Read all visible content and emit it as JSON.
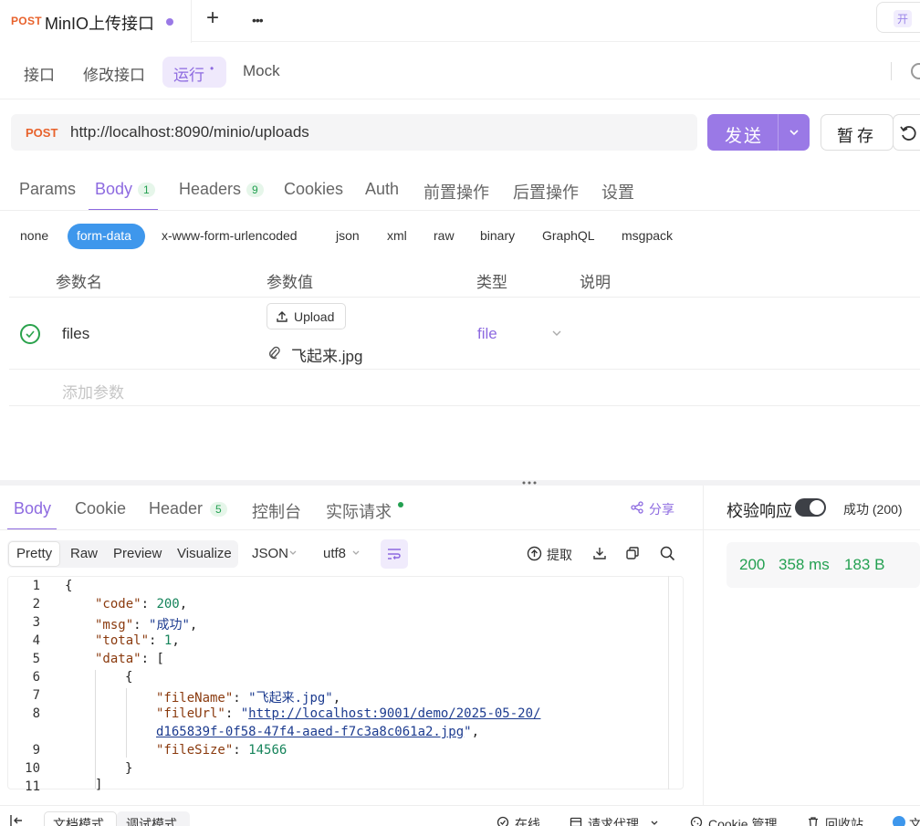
{
  "tab": {
    "method": "POST",
    "title": "MinIO上传接口",
    "add": "+",
    "more": "•••",
    "open": "开"
  },
  "subnav": {
    "items": [
      "接口",
      "修改接口",
      "运行",
      "Mock"
    ],
    "active_dot": "•"
  },
  "url": {
    "method": "POST",
    "value": "http://localhost:8090/minio/uploads"
  },
  "actions": {
    "send": "发送",
    "save": "暂存"
  },
  "request_tabs": [
    {
      "label": "Params"
    },
    {
      "label": "Body",
      "badge": "1"
    },
    {
      "label": "Headers",
      "badge": "9"
    },
    {
      "label": "Cookies"
    },
    {
      "label": "Auth"
    },
    {
      "label": "前置操作"
    },
    {
      "label": "后置操作"
    },
    {
      "label": "设置"
    }
  ],
  "body_types": [
    "none",
    "form-data",
    "x-www-form-urlencoded",
    "json",
    "xml",
    "raw",
    "binary",
    "GraphQL",
    "msgpack"
  ],
  "params_table": {
    "headers": [
      "参数名",
      "参数值",
      "类型",
      "说明"
    ],
    "rows": [
      {
        "name": "files",
        "upload_label": "Upload",
        "file": "飞起来.jpg",
        "type": "file"
      }
    ],
    "add_placeholder": "添加参数"
  },
  "response_tabs": [
    {
      "label": "Body"
    },
    {
      "label": "Cookie"
    },
    {
      "label": "Header",
      "badge": "5"
    },
    {
      "label": "控制台"
    },
    {
      "label": "实际请求"
    }
  ],
  "share": "分享",
  "format": {
    "modes": [
      "Pretty",
      "Raw",
      "Preview",
      "Visualize"
    ],
    "lang": "JSON",
    "encoding": "utf8",
    "extract": "提取"
  },
  "code": {
    "line_numbers": [
      "1",
      "2",
      "3",
      "4",
      "5",
      "6",
      "7",
      "8",
      "",
      "9",
      "10",
      "11"
    ],
    "open_brace": "{",
    "code_key": "\"code\"",
    "code_val": "200",
    "msg_key": "\"msg\"",
    "msg_val": "\"成功\"",
    "total_key": "\"total\"",
    "total_val": "1",
    "data_key": "\"data\"",
    "item_open": "{",
    "filename_key": "\"fileName\"",
    "filename_val": "\"飞起来.jpg\"",
    "fileurl_key": "\"fileUrl\"",
    "fileurl_q": "\"",
    "fileurl_part1": "http://localhost:9001/demo/2025-05-20/",
    "fileurl_part2": "d165839f-0f58-47f4-aaed-f7c3a8c061a2.jpg",
    "filesize_key": "\"fileSize\"",
    "filesize_val": "14566",
    "item_close": "}",
    "arr_close": "]"
  },
  "validation": {
    "label": "校验响应",
    "status": "成功 (200)"
  },
  "metrics": {
    "status": "200",
    "time": "358 ms",
    "size": "183 B"
  },
  "footer": {
    "items": [
      "文档模式",
      "调试模式",
      "在线",
      "请求代理",
      "Cookie 管理",
      "回收站",
      "文"
    ]
  },
  "colors": {
    "accent": "#8d6ae0",
    "method_post": "#e8622c",
    "success": "#23a051",
    "pill_blue": "#3e97ec"
  }
}
